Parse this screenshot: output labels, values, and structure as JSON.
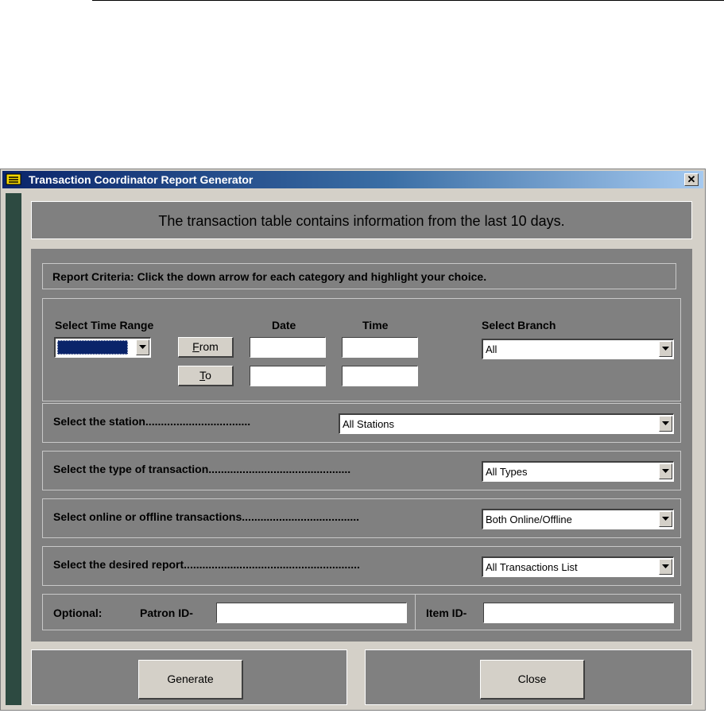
{
  "window": {
    "title": "Transaction Coordinator Report Generator",
    "close_glyph": "✕"
  },
  "info_message": "The transaction table contains information from the last 10 days.",
  "criteria_text": "Report Criteria:  Click the down arrow for each category and highlight your choice.",
  "time_range": {
    "label": "Select Time Range",
    "date_header": "Date",
    "time_header": "Time",
    "from_accel": "F",
    "from_rest": "rom",
    "to_accel": "T",
    "to_rest": "o",
    "from_date": "",
    "from_time": "",
    "to_date": "",
    "to_time": ""
  },
  "branch": {
    "label": "Select Branch",
    "value": "All"
  },
  "station": {
    "label": "Select the station..................................",
    "value": "All Stations"
  },
  "type": {
    "label": "Select the type of transaction..............................................",
    "value": "All Types"
  },
  "online": {
    "label": "Select online or offline transactions......................................",
    "value": "Both Online/Offline"
  },
  "report": {
    "label": "Select the desired report.........................................................",
    "value": "All Transactions List"
  },
  "optional": {
    "label": "Optional:",
    "patron_label": "Patron ID-",
    "patron_value": "",
    "item_label": "Item ID-",
    "item_value": ""
  },
  "buttons": {
    "generate": "Generate",
    "close": "Close"
  },
  "colors": {
    "panel": "#808080",
    "window": "#d4d0c8",
    "sidebar": "#2d4a41",
    "selection": "#0a246a"
  }
}
